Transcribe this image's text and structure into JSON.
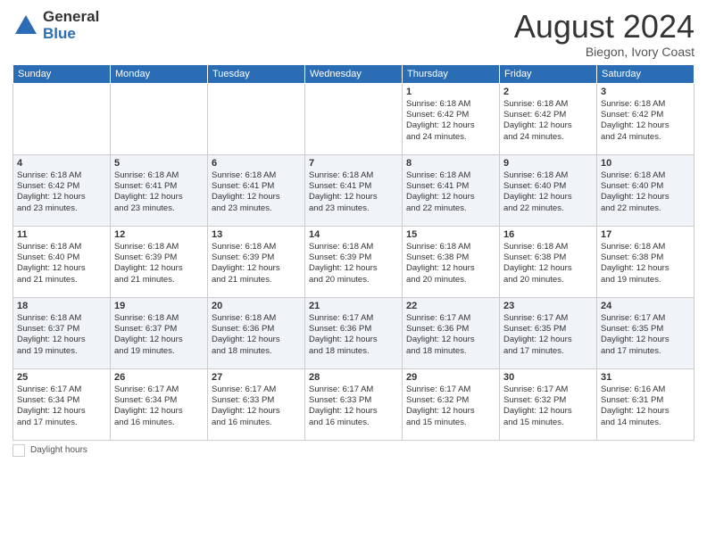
{
  "header": {
    "logo_general": "General",
    "logo_blue": "Blue",
    "month": "August 2024",
    "location": "Biegon, Ivory Coast"
  },
  "days_of_week": [
    "Sunday",
    "Monday",
    "Tuesday",
    "Wednesday",
    "Thursday",
    "Friday",
    "Saturday"
  ],
  "weeks": [
    [
      {
        "day": "",
        "info": ""
      },
      {
        "day": "",
        "info": ""
      },
      {
        "day": "",
        "info": ""
      },
      {
        "day": "",
        "info": ""
      },
      {
        "day": "1",
        "info": "Sunrise: 6:18 AM\nSunset: 6:42 PM\nDaylight: 12 hours\nand 24 minutes."
      },
      {
        "day": "2",
        "info": "Sunrise: 6:18 AM\nSunset: 6:42 PM\nDaylight: 12 hours\nand 24 minutes."
      },
      {
        "day": "3",
        "info": "Sunrise: 6:18 AM\nSunset: 6:42 PM\nDaylight: 12 hours\nand 24 minutes."
      }
    ],
    [
      {
        "day": "4",
        "info": "Sunrise: 6:18 AM\nSunset: 6:42 PM\nDaylight: 12 hours\nand 23 minutes."
      },
      {
        "day": "5",
        "info": "Sunrise: 6:18 AM\nSunset: 6:41 PM\nDaylight: 12 hours\nand 23 minutes."
      },
      {
        "day": "6",
        "info": "Sunrise: 6:18 AM\nSunset: 6:41 PM\nDaylight: 12 hours\nand 23 minutes."
      },
      {
        "day": "7",
        "info": "Sunrise: 6:18 AM\nSunset: 6:41 PM\nDaylight: 12 hours\nand 23 minutes."
      },
      {
        "day": "8",
        "info": "Sunrise: 6:18 AM\nSunset: 6:41 PM\nDaylight: 12 hours\nand 22 minutes."
      },
      {
        "day": "9",
        "info": "Sunrise: 6:18 AM\nSunset: 6:40 PM\nDaylight: 12 hours\nand 22 minutes."
      },
      {
        "day": "10",
        "info": "Sunrise: 6:18 AM\nSunset: 6:40 PM\nDaylight: 12 hours\nand 22 minutes."
      }
    ],
    [
      {
        "day": "11",
        "info": "Sunrise: 6:18 AM\nSunset: 6:40 PM\nDaylight: 12 hours\nand 21 minutes."
      },
      {
        "day": "12",
        "info": "Sunrise: 6:18 AM\nSunset: 6:39 PM\nDaylight: 12 hours\nand 21 minutes."
      },
      {
        "day": "13",
        "info": "Sunrise: 6:18 AM\nSunset: 6:39 PM\nDaylight: 12 hours\nand 21 minutes."
      },
      {
        "day": "14",
        "info": "Sunrise: 6:18 AM\nSunset: 6:39 PM\nDaylight: 12 hours\nand 20 minutes."
      },
      {
        "day": "15",
        "info": "Sunrise: 6:18 AM\nSunset: 6:38 PM\nDaylight: 12 hours\nand 20 minutes."
      },
      {
        "day": "16",
        "info": "Sunrise: 6:18 AM\nSunset: 6:38 PM\nDaylight: 12 hours\nand 20 minutes."
      },
      {
        "day": "17",
        "info": "Sunrise: 6:18 AM\nSunset: 6:38 PM\nDaylight: 12 hours\nand 19 minutes."
      }
    ],
    [
      {
        "day": "18",
        "info": "Sunrise: 6:18 AM\nSunset: 6:37 PM\nDaylight: 12 hours\nand 19 minutes."
      },
      {
        "day": "19",
        "info": "Sunrise: 6:18 AM\nSunset: 6:37 PM\nDaylight: 12 hours\nand 19 minutes."
      },
      {
        "day": "20",
        "info": "Sunrise: 6:18 AM\nSunset: 6:36 PM\nDaylight: 12 hours\nand 18 minutes."
      },
      {
        "day": "21",
        "info": "Sunrise: 6:17 AM\nSunset: 6:36 PM\nDaylight: 12 hours\nand 18 minutes."
      },
      {
        "day": "22",
        "info": "Sunrise: 6:17 AM\nSunset: 6:36 PM\nDaylight: 12 hours\nand 18 minutes."
      },
      {
        "day": "23",
        "info": "Sunrise: 6:17 AM\nSunset: 6:35 PM\nDaylight: 12 hours\nand 17 minutes."
      },
      {
        "day": "24",
        "info": "Sunrise: 6:17 AM\nSunset: 6:35 PM\nDaylight: 12 hours\nand 17 minutes."
      }
    ],
    [
      {
        "day": "25",
        "info": "Sunrise: 6:17 AM\nSunset: 6:34 PM\nDaylight: 12 hours\nand 17 minutes."
      },
      {
        "day": "26",
        "info": "Sunrise: 6:17 AM\nSunset: 6:34 PM\nDaylight: 12 hours\nand 16 minutes."
      },
      {
        "day": "27",
        "info": "Sunrise: 6:17 AM\nSunset: 6:33 PM\nDaylight: 12 hours\nand 16 minutes."
      },
      {
        "day": "28",
        "info": "Sunrise: 6:17 AM\nSunset: 6:33 PM\nDaylight: 12 hours\nand 16 minutes."
      },
      {
        "day": "29",
        "info": "Sunrise: 6:17 AM\nSunset: 6:32 PM\nDaylight: 12 hours\nand 15 minutes."
      },
      {
        "day": "30",
        "info": "Sunrise: 6:17 AM\nSunset: 6:32 PM\nDaylight: 12 hours\nand 15 minutes."
      },
      {
        "day": "31",
        "info": "Sunrise: 6:16 AM\nSunset: 6:31 PM\nDaylight: 12 hours\nand 14 minutes."
      }
    ]
  ],
  "footer": {
    "daylight_label": "Daylight hours"
  }
}
